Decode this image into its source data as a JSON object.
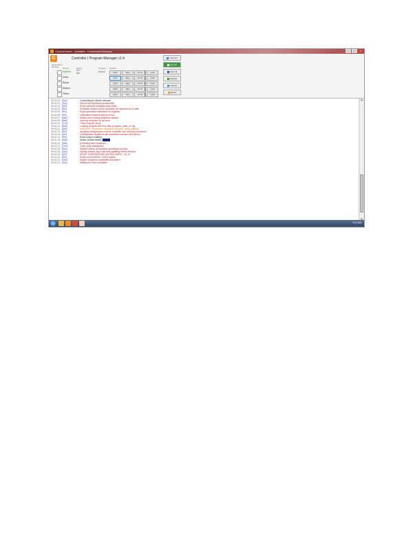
{
  "window": {
    "title": "ControlCenter - [Untitled - Connected Devices]",
    "min": "–",
    "max": "□",
    "close": "×"
  },
  "panel": {
    "logo": "C",
    "subtitle": "Connected",
    "subtitle2": "devices",
    "header_title": "Controller | Program Manager v1.4",
    "col_device": "Device",
    "col_status": "Status",
    "col_program": "Program",
    "col_actions": "Actions"
  },
  "devices": [
    {
      "name": "System",
      "green": true,
      "extra": "Run\nIdle",
      "extra2": "Mode A",
      "buttons": [
        "Start",
        "Stop",
        "Go To",
        "Load"
      ]
    },
    {
      "name": "Drive",
      "green": false,
      "extra": "",
      "extra2": "",
      "buttons": [
        "Start",
        "Stop",
        "Go To",
        "Load"
      ]
    },
    {
      "name": "Pulse",
      "green": false,
      "extra": "",
      "extra2": "",
      "buttons": [
        "Start",
        "Stop",
        "Go To",
        "Load"
      ]
    },
    {
      "name": "Motion",
      "green": false,
      "extra": "",
      "extra2": "",
      "buttons": [
        "Start",
        "Stop",
        "Go To",
        "Load"
      ]
    },
    {
      "name": "Timer",
      "green": false,
      "extra": "",
      "extra2": "",
      "buttons": [
        "Start",
        "Stop",
        "Go To",
        "Load"
      ]
    }
  ],
  "side_buttons": [
    "Connect",
    "Run All",
    "Stop All",
    "Settings",
    "Upload",
    "Export"
  ],
  "log": [
    {
      "time": "09:41:02",
      "src": "[Sys]",
      "msg": "Connecting to device network...",
      "color": "#222222"
    },
    {
      "time": "09:41:03",
      "src": "[Sys]",
      "msg": "Device list refreshed successfully",
      "color": "#c0202a"
    },
    {
      "time": "09:41:03",
      "src": "[Drv]",
      "msg": "Drive controller initialised and ready",
      "color": "#c0202a"
    },
    {
      "time": "09:41:04",
      "src": "[Drv]",
      "msg": "Firmware version check complete: all modules up to date",
      "color": "#c0202a"
    },
    {
      "time": "09:41:05",
      "src": "[Pls]",
      "msg": "Pulse generator calibration in progress",
      "color": "#c0202a"
    },
    {
      "time": "09:41:06",
      "src": "[Pls]",
      "msg": "Calibration finished without errors",
      "color": "#c0202a"
    },
    {
      "time": "09:41:07",
      "src": "[Mot]",
      "msg": "Motion axis homing sequence started",
      "color": "#c0202a"
    },
    {
      "time": "09:41:08",
      "src": "[Mot]",
      "msg": "Homing complete on all axes",
      "color": "#c0202a"
    },
    {
      "time": "09:41:09",
      "src": "[Tmr]",
      "msg": "Timer module online",
      "color": "#c0202a"
    },
    {
      "time": "09:41:10",
      "src": "[Sys]",
      "msg": "Loading program file from disk: program_main_v2.cfg",
      "color": "#c0202a"
    },
    {
      "time": "09:41:11",
      "src": "[Sys]",
      "msg": "WARNING: parameter mismatch detected, using defaults",
      "color": "#e0801a"
    },
    {
      "time": "09:41:12",
      "src": "[Drv]",
      "msg": "Applying configuration to drive controller and verifying checksum",
      "color": "#c0202a"
    },
    {
      "time": "09:41:13",
      "src": "[Drv]",
      "msg": "Configuration applied to all connected modules and stored",
      "color": "#c0202a"
    },
    {
      "time": "09:41:14",
      "src": "[Pls]",
      "msg": "Pulse output enabled",
      "color": "#222222"
    },
    {
      "time": "09:41:15",
      "src": "[Mot]",
      "msg": "Motion profile loaded",
      "color": "#222222",
      "highlight": "ready"
    },
    {
      "time": "09:41:16",
      "src": "[Mot]",
      "msg": "Executing test movement",
      "color": "#c0202a"
    },
    {
      "time": "09:41:17",
      "src": "[Tmr]",
      "msg": "Timer sync established",
      "color": "#c0202a"
    },
    {
      "time": "09:41:18",
      "src": "[Sys]",
      "msg": "System status: all modules operating normally",
      "color": "#c0202a"
    },
    {
      "time": "09:41:19",
      "src": "[Sys]",
      "msg": "Saving session log to file and updating history records",
      "color": "#c0202a"
    },
    {
      "time": "09:41:20",
      "src": "[Drv]",
      "msg": "DRIVE TEMPERATURE WITHIN LIMITS - 41.2C",
      "color": "#c0202a"
    },
    {
      "time": "09:41:21",
      "src": "[Pls]",
      "msg": "Pulse count verified: 12000 pulses",
      "color": "#c0202a"
    },
    {
      "time": "09:41:22",
      "src": "[Mot]",
      "msg": "Motion sequence completed at position",
      "color": "#c0202a"
    },
    {
      "time": "09:41:23",
      "src": "[Sys]",
      "msg": "Waiting for next command...",
      "color": "#c0202a"
    }
  ],
  "taskbar": {
    "tray_time": "9:41 AM"
  },
  "colors": {
    "accent": "#f08a24",
    "titlebar": "#6b1f1f",
    "log_source": "#3a44c8",
    "log_error": "#c0202a"
  }
}
